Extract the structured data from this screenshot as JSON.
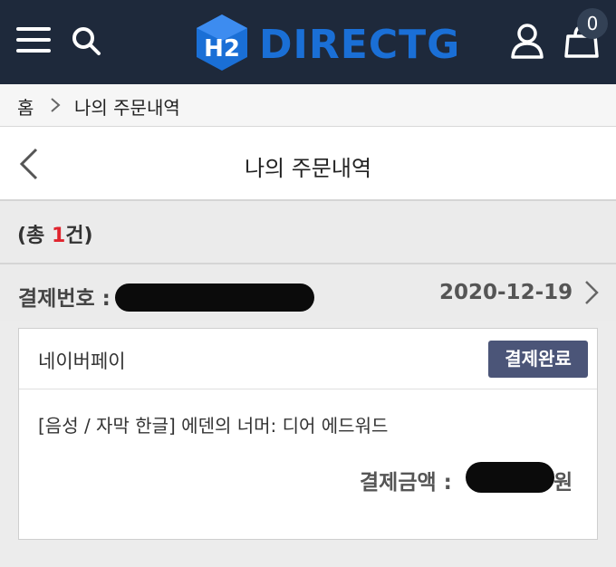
{
  "header": {
    "logo_mark": "H2",
    "logo_text": "DIRECTG",
    "cart_count": "0",
    "brand_color": "#1a6fd6",
    "bar_color": "#1e293b"
  },
  "breadcrumb": {
    "home": "홈",
    "current": "나의 주문내역"
  },
  "page": {
    "title": "나의 주문내역"
  },
  "summary": {
    "prefix": "(총 ",
    "count": "1",
    "suffix": "건)"
  },
  "order": {
    "number_label": "결제번호 :",
    "date": "2020-12-19",
    "payment_method": "네이버페이",
    "status": "결제완료",
    "product_name": "[음성 / 자막 한글] 에덴의 너머: 디어 에드워드",
    "amount_label": "결제금액 :",
    "currency_unit": "원",
    "status_color": "#4b5578"
  },
  "icons": [
    "menu-icon",
    "search-icon",
    "user-icon",
    "cart-icon",
    "chevron-right-icon",
    "back-arrow-icon"
  ]
}
